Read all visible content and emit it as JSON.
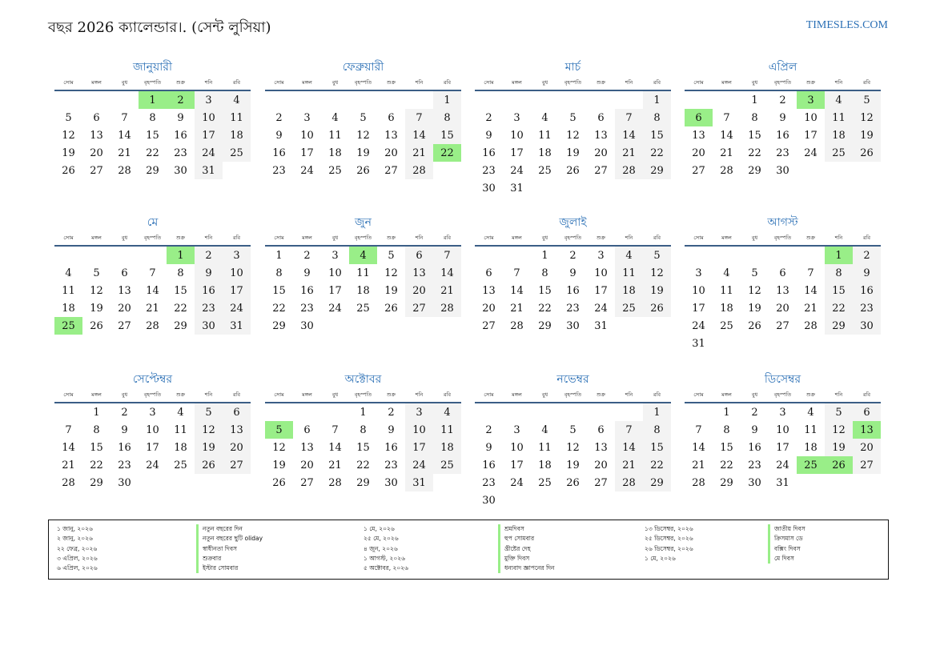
{
  "title": "বছর 2026 ক্যালেন্ডার।. (সেন্ট লুসিয়া)",
  "site": "TIMESLES.COM",
  "colors": {
    "accent": "#2a6fb5",
    "holiday": "#99ee88",
    "weekend": "#f3f3f3",
    "rule": "#3b5e86"
  },
  "weekdays": [
    "সোম",
    "মঙ্গল",
    "বুধ",
    "বৃহস্পতি",
    "শুক্র",
    "শনি",
    "রবি"
  ],
  "months": [
    {
      "name": "জানুয়ারী",
      "offset": 3,
      "days": 31,
      "holidays": [
        1,
        2
      ]
    },
    {
      "name": "ফেব্রুয়ারী",
      "offset": 6,
      "days": 28,
      "holidays": [
        22
      ]
    },
    {
      "name": "মার্চ",
      "offset": 6,
      "days": 31,
      "holidays": []
    },
    {
      "name": "এপ্রিল",
      "offset": 2,
      "days": 30,
      "holidays": [
        3,
        6
      ]
    },
    {
      "name": "মে",
      "offset": 4,
      "days": 31,
      "holidays": [
        1,
        25
      ]
    },
    {
      "name": "জুন",
      "offset": 0,
      "days": 30,
      "holidays": [
        4
      ]
    },
    {
      "name": "জুলাই",
      "offset": 2,
      "days": 31,
      "holidays": []
    },
    {
      "name": "আগস্ট",
      "offset": 5,
      "days": 31,
      "holidays": [
        1
      ]
    },
    {
      "name": "সেপ্টেম্বর",
      "offset": 1,
      "days": 30,
      "holidays": []
    },
    {
      "name": "অক্টোবর",
      "offset": 3,
      "days": 31,
      "holidays": [
        5
      ]
    },
    {
      "name": "নভেম্বর",
      "offset": 6,
      "days": 30,
      "holidays": []
    },
    {
      "name": "ডিসেম্বর",
      "offset": 1,
      "days": 31,
      "holidays": [
        13,
        25,
        26
      ]
    }
  ],
  "holiday_list": [
    {
      "date": "১ জানু, ২০২৬",
      "name": "নতুন বছরের দিন"
    },
    {
      "date": "২ জানু, ২০২৬",
      "name": "নতুন বছরের ছুটি oliday"
    },
    {
      "date": "২২ ফেব্র, ২০২৬",
      "name": "স্বাধীনতা দিবস"
    },
    {
      "date": "৩ এপ্রিল, ২০২৬",
      "name": "শুক্রবার"
    },
    {
      "date": "৬ এপ্রিল, ২০২৬",
      "name": "ইস্টার সোমবার"
    },
    {
      "date": "১ মে, ২০২৬",
      "name": "শ্রমদিবস"
    },
    {
      "date": "২৫ মে, ২০২৬",
      "name": "হুপ সোমবার"
    },
    {
      "date": "৪ জুন, ২০২৬",
      "name": "খ্রীষ্টের দেহ"
    },
    {
      "date": "১ আগস্ট, ২০২৬",
      "name": "মুক্তি দিবস"
    },
    {
      "date": "৫ অক্টোবর, ২০২৬",
      "name": "ধন্যবাদ জ্ঞাপনের দিন"
    },
    {
      "date": "১৩ ডিসেম্বর, ২০২৬",
      "name": "জাতীয় দিবস"
    },
    {
      "date": "২৫ ডিসেম্বর, ২০২৬",
      "name": "ক্রিসমাস ডে"
    },
    {
      "date": "২৬ ডিসেম্বর, ২০২৬",
      "name": "বক্সিং দিবস"
    },
    {
      "date": "১ মে, ২০২৬",
      "name": "মে দিবস"
    }
  ]
}
